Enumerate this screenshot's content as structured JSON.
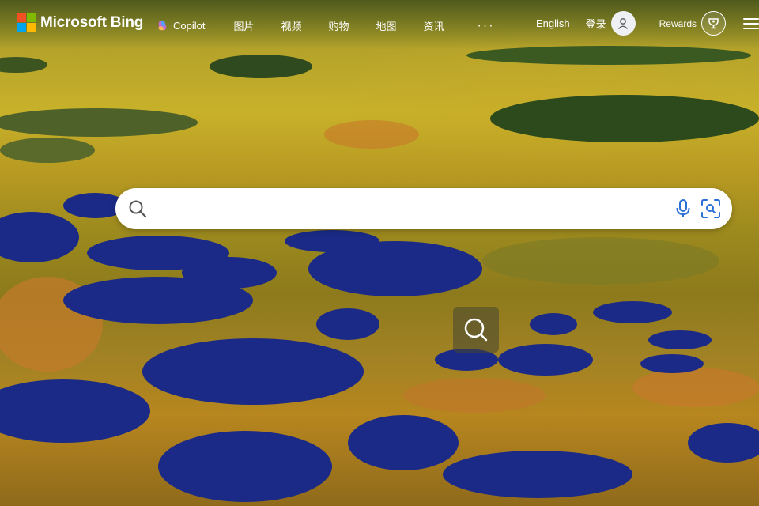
{
  "brand": {
    "name": "Microsoft Bing",
    "logo_colors": [
      "#f25022",
      "#7fba00",
      "#00a4ef",
      "#ffb900"
    ]
  },
  "nav": {
    "copilot_label": "Copilot",
    "items": [
      "图片",
      "视频",
      "购物",
      "地图",
      "资讯"
    ],
    "more_label": "···"
  },
  "header": {
    "language_label": "English",
    "login_label": "登录",
    "rewards_label": "Rewards"
  },
  "search": {
    "value": "",
    "placeholder": ""
  },
  "icons": {
    "search": "search-icon",
    "microphone": "microphone-icon",
    "visual_search": "visual-search-icon",
    "user": "user-icon",
    "rewards": "trophy-icon",
    "menu": "hamburger-menu-icon",
    "lens": "image-search-lens-icon"
  }
}
